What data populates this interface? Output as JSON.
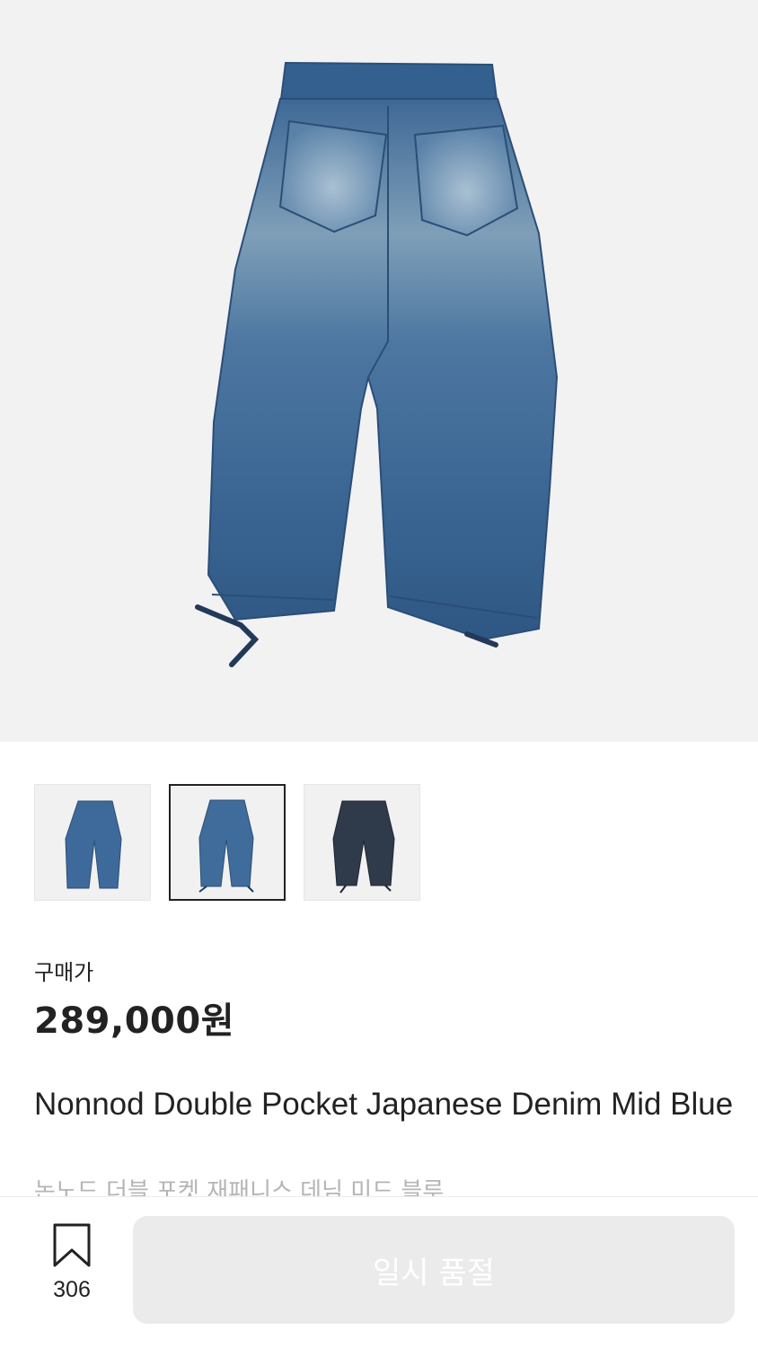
{
  "product": {
    "price_label": "구매가",
    "price": "289,000원",
    "name_en": "Nonnod Double Pocket Japanese Denim Mid Blue",
    "name_ko": "논노드 더블 포켓 재패니스 데님 미드 블루"
  },
  "gallery": {
    "thumbnails": [
      {
        "color": "#3d6a9a",
        "selected": false
      },
      {
        "color": "#3f6c9b",
        "selected": true
      },
      {
        "color": "#2f3a4a",
        "selected": false
      }
    ]
  },
  "bottom_bar": {
    "wish_icon": "bookmark-icon",
    "wish_count": "306",
    "buy_label": "일시 품절"
  },
  "colors": {
    "denim": "#3f6b98",
    "denim_light": "#8fb0c8",
    "denim_dark": "#2d4f78",
    "button_disabled": "#ebebeb"
  }
}
